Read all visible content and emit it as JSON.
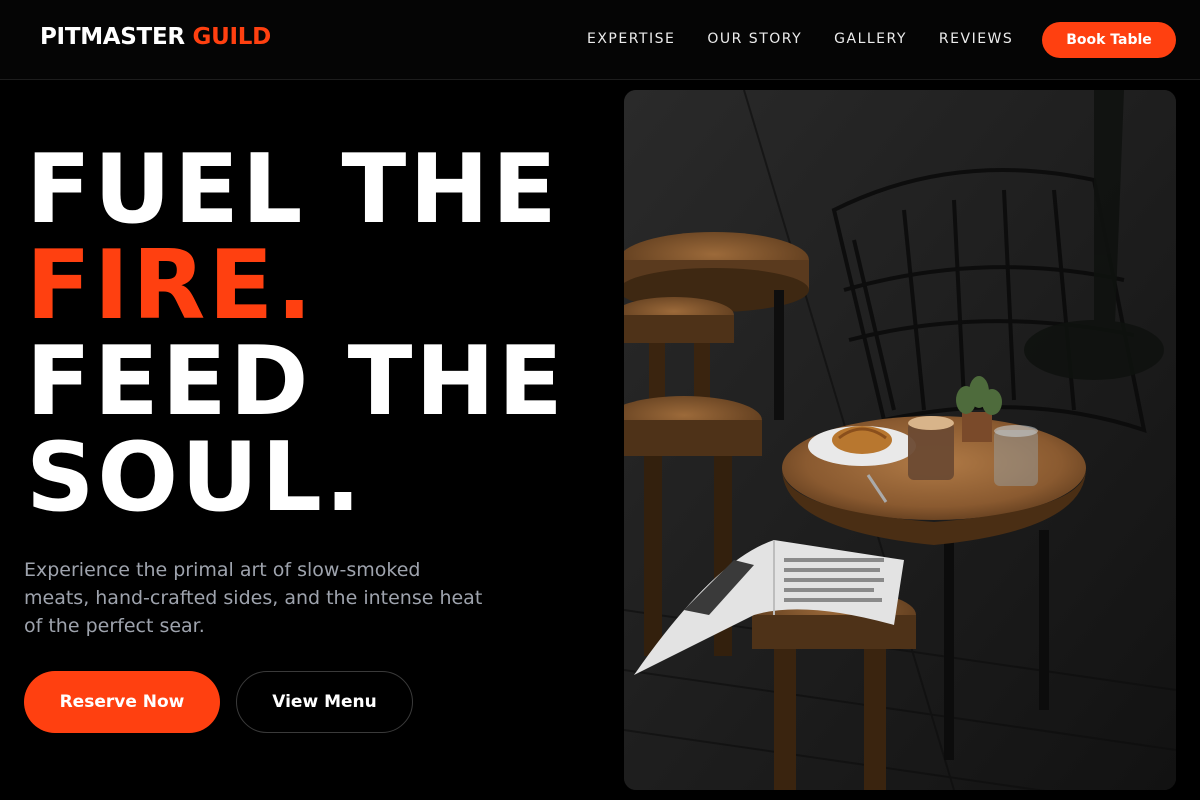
{
  "nav": {
    "brand_main": "PITMASTER",
    "brand_accent": "GUILD",
    "links": [
      "EXPERTISE",
      "OUR STORY",
      "GALLERY",
      "REVIEWS"
    ],
    "cta": "Book Table"
  },
  "hero": {
    "line1": "FUEL THE",
    "line2": "FIRE.",
    "line3": "FEED THE",
    "line4": "SOUL.",
    "subtext": "Experience the primal art of slow-smoked meats, hand-crafted sides, and the intense heat of the perfect sear.",
    "primary_button": "Reserve Now",
    "secondary_button": "View Menu"
  },
  "colors": {
    "accent": "#ff4010",
    "background": "#000000",
    "muted_text": "#9ea3ad"
  }
}
